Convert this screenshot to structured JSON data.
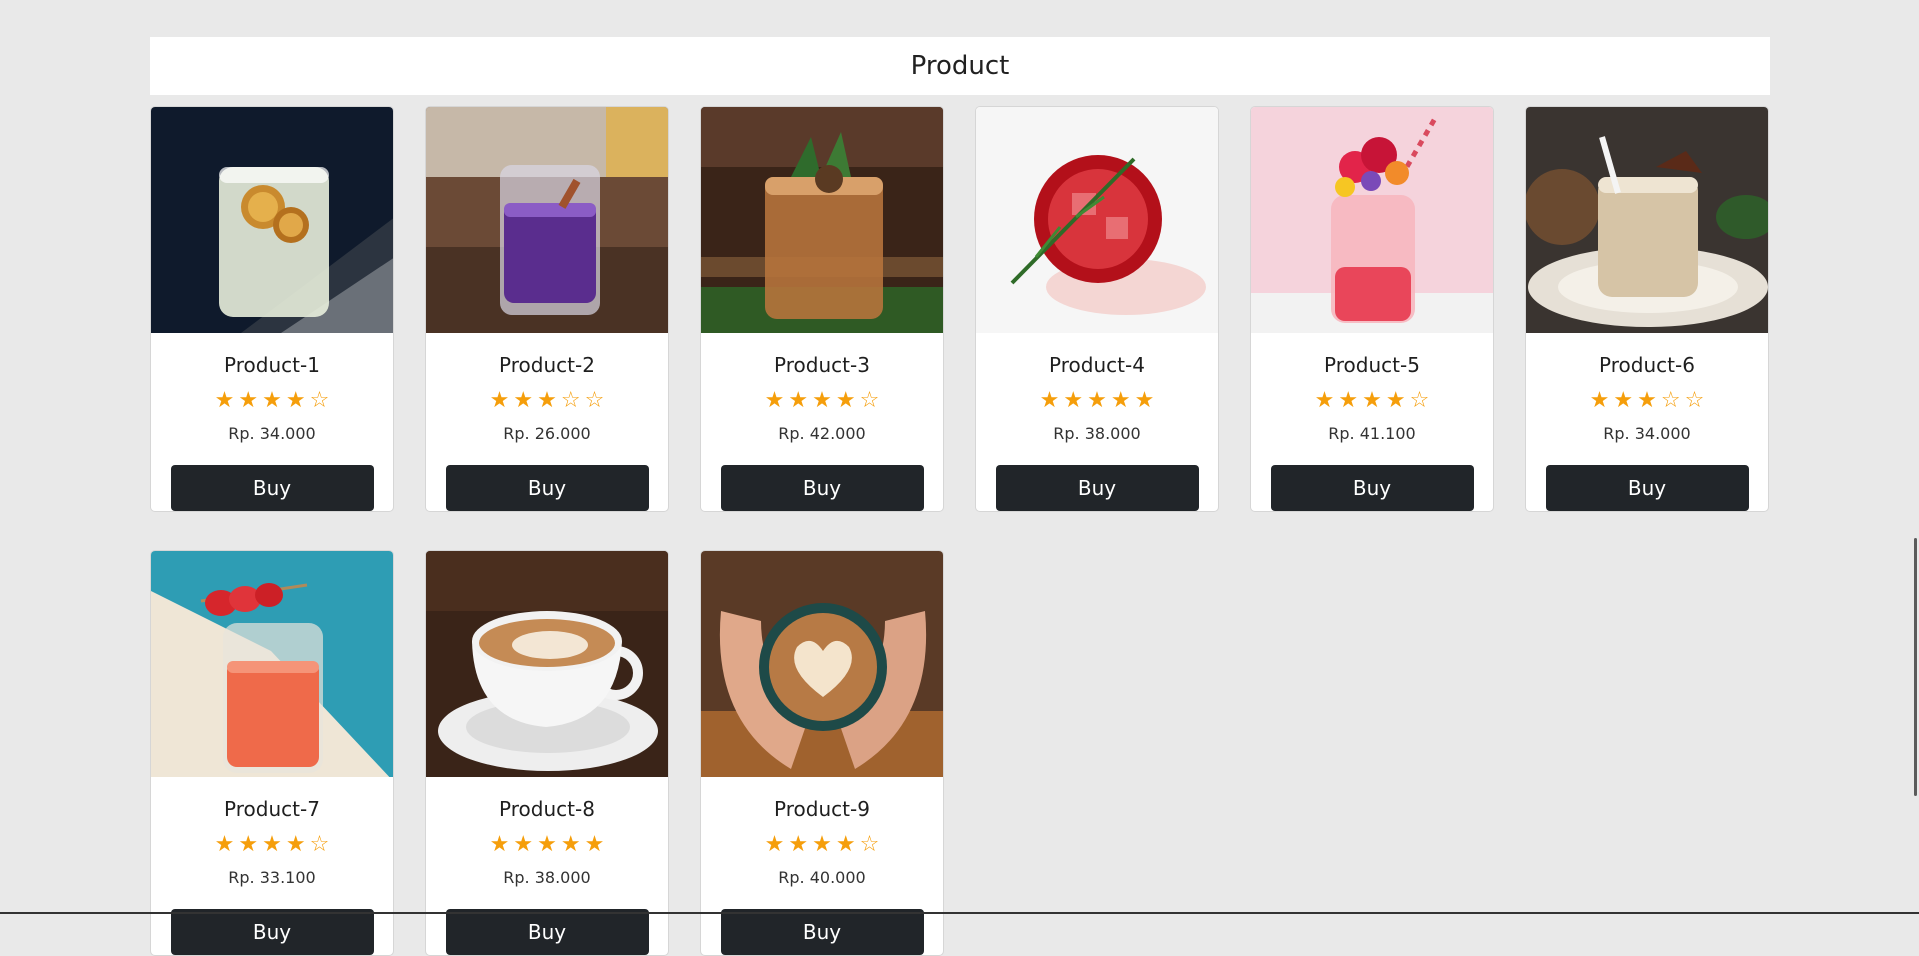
{
  "header": {
    "title": "Product"
  },
  "colors": {
    "star": "#f59e0b",
    "button": "#212529",
    "background": "#e9e9e9"
  },
  "products": [
    {
      "name": "Product-1",
      "rating": 4,
      "price": "Rp. 34.000",
      "buy_label": "Buy",
      "image": "lemon-cocktail-image"
    },
    {
      "name": "Product-2",
      "rating": 3,
      "price": "Rp. 26.000",
      "buy_label": "Buy",
      "image": "purple-drink-image"
    },
    {
      "name": "Product-3",
      "rating": 4,
      "price": "Rp. 42.000",
      "buy_label": "Buy",
      "image": "whiskey-cocktail-image"
    },
    {
      "name": "Product-4",
      "rating": 5,
      "price": "Rp. 38.000",
      "buy_label": "Buy",
      "image": "red-drink-rosemary-image"
    },
    {
      "name": "Product-5",
      "rating": 4,
      "price": "Rp. 41.100",
      "buy_label": "Buy",
      "image": "flower-jar-drink-image"
    },
    {
      "name": "Product-6",
      "rating": 3,
      "price": "Rp. 34.000",
      "buy_label": "Buy",
      "image": "coconut-drink-image"
    },
    {
      "name": "Product-7",
      "rating": 4,
      "price": "Rp. 33.100",
      "buy_label": "Buy",
      "image": "strawberry-drink-image"
    },
    {
      "name": "Product-8",
      "rating": 5,
      "price": "Rp. 38.000",
      "buy_label": "Buy",
      "image": "latte-cup-image"
    },
    {
      "name": "Product-9",
      "rating": 4,
      "price": "Rp. 40.000",
      "buy_label": "Buy",
      "image": "latte-hands-image"
    }
  ]
}
